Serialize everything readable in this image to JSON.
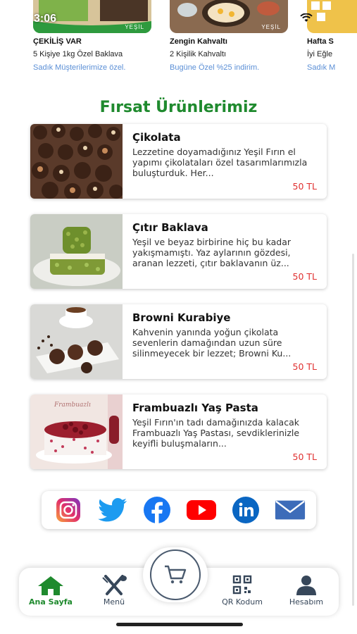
{
  "status_bar": {
    "time": "3:06"
  },
  "promos": [
    {
      "title": "ÇEKİLİŞ VAR",
      "subtitle": "5 Kişiye 1kg Özel Baklava",
      "link": "Sadık Müşterilerimize özel.",
      "brand": "YEŞİL",
      "accent": "#1f8a2e"
    },
    {
      "title": "Zengin Kahvaltı",
      "subtitle": "2 Kişilik Kahvaltı",
      "link": "Bugüne Özel %25 indirim.",
      "brand": "YEŞİL",
      "accent": "#6a4b35"
    },
    {
      "title": "Hafta S",
      "subtitle": "İyi Eğle",
      "link": "Sadık M",
      "brand": "",
      "accent": "#e9b13b"
    }
  ],
  "section_title": "Fırsat Ürünlerimiz",
  "products": [
    {
      "name": "Çikolata",
      "description": "Lezzetine doyamadığınız Yeşil Fırın el yapımı çikolataları özel tasarımlarımızla buluşturduk. Her...",
      "price": "50 TL",
      "image": "chocolate-pralines"
    },
    {
      "name": "Çıtır Baklava",
      "description": "Yeşil ve beyaz birbirine hiç bu kadar yakışmamıştı. Yaz aylarının gözdesi, aranan lezzeti, çıtır baklavanın üz...",
      "price": "50 TL",
      "image": "pistachio-baklava"
    },
    {
      "name": "Browni Kurabiye",
      "description": "Kahvenin yanında yoğun çikolata sevenlerin damağından uzun süre silinmeyecek bir lezzet; Browni Ku...",
      "price": "50 TL",
      "image": "brownie-cookies"
    },
    {
      "name": "Frambuazlı Yaş Pasta",
      "description": "Yeşil Fırın'ın tadı damağınızda kalacak Frambuazlı Yaş Pastası, sevdiklerinizle keyifli buluşmaların...",
      "price": "50 TL",
      "image": "raspberry-cake",
      "image_caption": "Frambuazlı"
    }
  ],
  "social": [
    {
      "name": "instagram-icon",
      "color": "#c13584"
    },
    {
      "name": "twitter-icon",
      "color": "#1d9bf0"
    },
    {
      "name": "facebook-icon",
      "color": "#1877f2"
    },
    {
      "name": "youtube-icon",
      "color": "#ff0000"
    },
    {
      "name": "linkedin-icon",
      "color": "#0a66c2"
    },
    {
      "name": "mail-icon",
      "color": "#3d6cb9"
    }
  ],
  "nav": {
    "home": "Ana Sayfa",
    "menu": "Menü",
    "qr": "QR Kodum",
    "account": "Hesabım",
    "active_color": "#1f8a2e",
    "inactive_color": "#37475a"
  }
}
